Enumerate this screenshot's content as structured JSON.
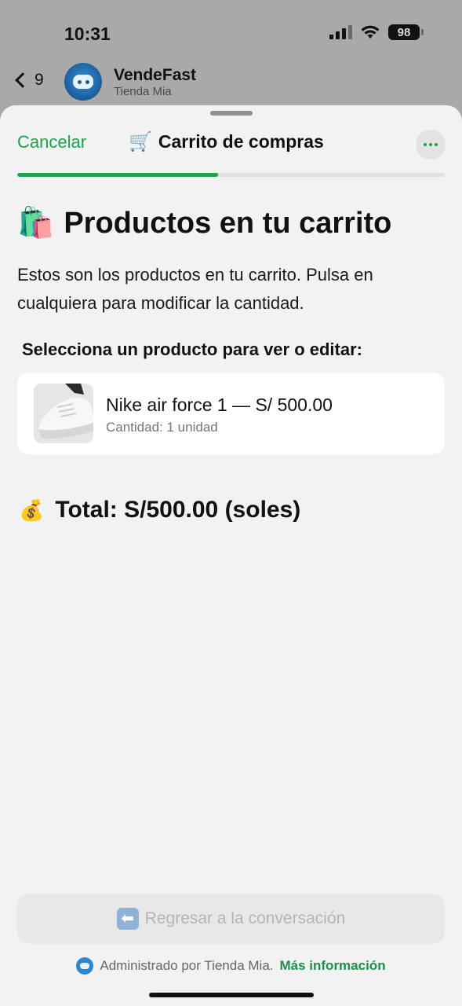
{
  "status_bar": {
    "time": "10:31",
    "battery": "98"
  },
  "chat_header": {
    "back_count": "9",
    "name": "VendeFast",
    "subtitle": "Tienda Mia"
  },
  "sheet": {
    "cancel_label": "Cancelar",
    "title_icon": "🛒",
    "title": "Carrito de compras",
    "progress_fraction": 0.47,
    "colors": {
      "accent": "#1da34f",
      "background": "#f2f2f2"
    }
  },
  "content": {
    "heading_icon": "🛍️",
    "heading": "Productos en tu carrito",
    "intro": "Estos son los productos en tu carrito. Pulsa en cualquiera para modificar la cantidad.",
    "section_label": "Selecciona un producto para ver o editar:",
    "products": [
      {
        "title": "Nike air force 1 — S/ 500.00",
        "quantity": "Cantidad: 1 unidad"
      }
    ],
    "total_icon": "💰",
    "total": "Total: S/500.00 (soles)"
  },
  "footer": {
    "back_button_icon": "⬅",
    "back_button_label": "Regresar a la conversación",
    "managed_by": "Administrado por Tienda Mia.",
    "more_info_link": "Más información"
  }
}
